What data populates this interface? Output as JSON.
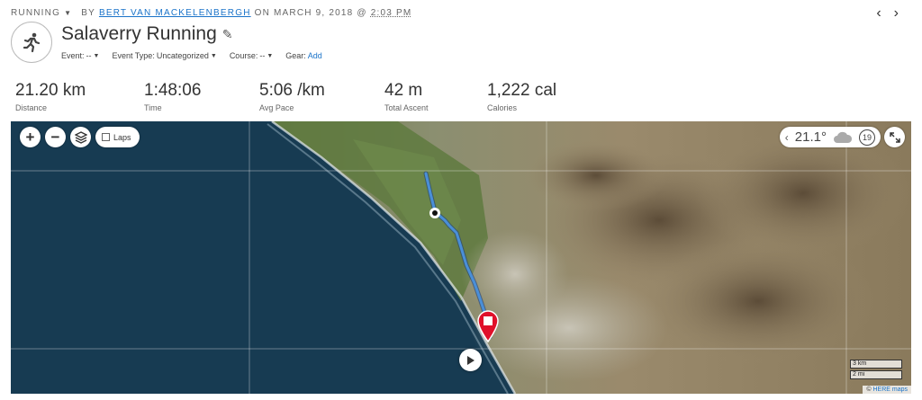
{
  "header": {
    "activity_type": "RUNNING",
    "by_label": "BY",
    "author": "BERT VAN MACKELENBERGH",
    "on_label": "ON MARCH 9, 2018 @",
    "time": "2:03 PM",
    "title": "Salaverry Running",
    "prev_label": "‹",
    "next_label": "›"
  },
  "meta": {
    "event_label": "Event:",
    "event_value": "--",
    "event_type_label": "Event Type:",
    "event_type_value": "Uncategorized",
    "course_label": "Course:",
    "course_value": "--",
    "gear_label": "Gear:",
    "gear_action": "Add"
  },
  "stats": [
    {
      "value": "21.20 km",
      "label": "Distance"
    },
    {
      "value": "1:48:06",
      "label": "Time"
    },
    {
      "value": "5:06 /km",
      "label": "Avg Pace"
    },
    {
      "value": "42 m",
      "label": "Total Ascent"
    },
    {
      "value": "1,222 cal",
      "label": "Calories"
    }
  ],
  "map": {
    "zoom_in": "+",
    "zoom_out": "−",
    "laps_label": "Laps",
    "laps_checked": false,
    "temperature": "21.1°",
    "wind_speed": "19",
    "scale_km": "3 km",
    "scale_mi": "2 mi",
    "attribution_prefix": "©",
    "attribution_provider": "HERE maps",
    "colors": {
      "ocean": "#173b52",
      "route": "#4a8fd8",
      "end_marker": "#e0102a"
    }
  }
}
